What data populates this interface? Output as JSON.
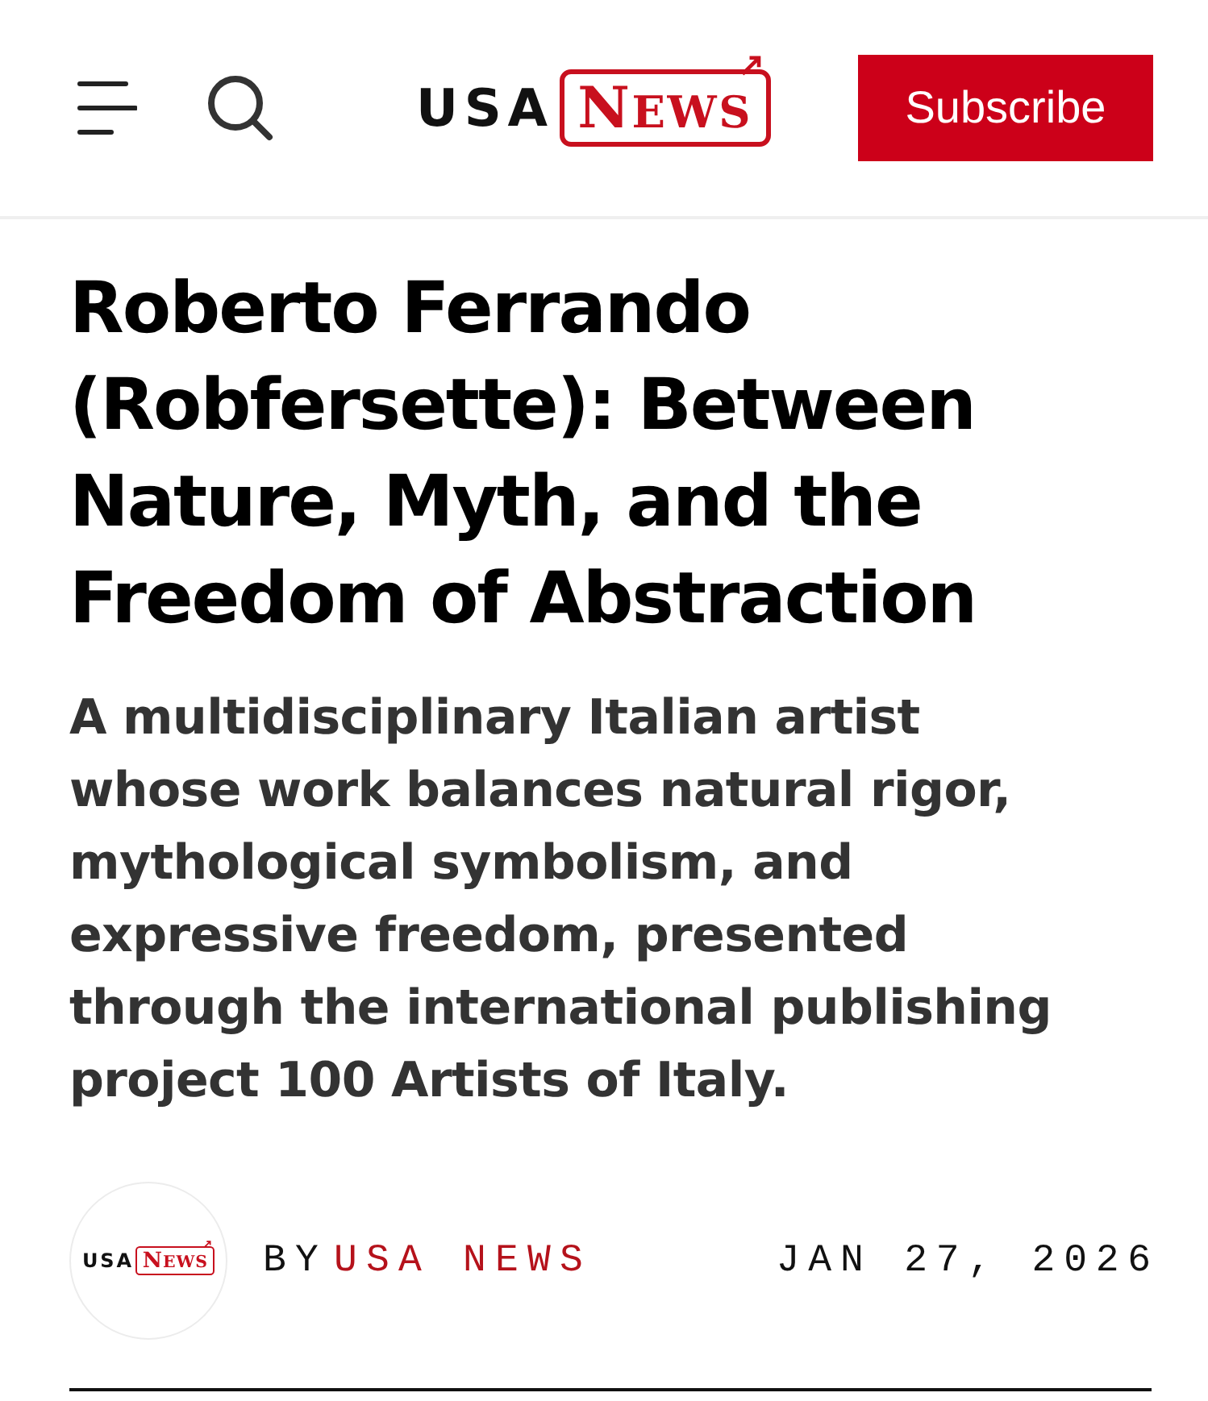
{
  "header": {
    "logo": {
      "left": "USA",
      "right": "NEWS"
    },
    "subscribe_button": "Subscribe"
  },
  "article": {
    "title": "Roberto Ferrando (Robfersette): Between Nature, Myth, and the Freedom of Abstraction",
    "subtitle": "A multidisciplinary Italian artist whose work balances natural rigor, mythological symbolism, and expressive freedom, presented through the international publishing project 100 Artists of Italy.",
    "byline": {
      "avatar_logo": {
        "left": "USA",
        "right": "NEWS"
      },
      "prefix": "BY",
      "author": "USA NEWS",
      "date": "JAN 27, 2026"
    }
  }
}
